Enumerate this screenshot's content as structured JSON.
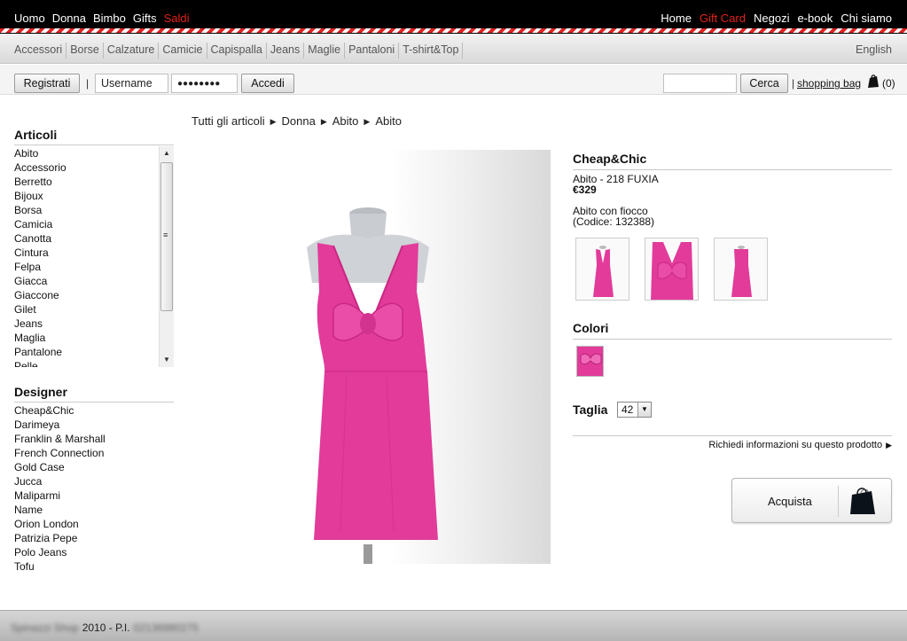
{
  "topnav": {
    "left": [
      {
        "label": "Uomo",
        "color": "#ffffff"
      },
      {
        "label": "Donna",
        "color": "#ffffff"
      },
      {
        "label": "Bimbo",
        "color": "#ffffff"
      },
      {
        "label": "Gifts",
        "color": "#ffffff"
      },
      {
        "label": "Saldi",
        "color": "#e32119"
      }
    ],
    "right": [
      {
        "label": "Home",
        "color": "#ffffff"
      },
      {
        "label": "Gift Card",
        "color": "#e32119"
      },
      {
        "label": "Negozi",
        "color": "#ffffff"
      },
      {
        "label": "e-book",
        "color": "#ffffff"
      },
      {
        "label": "Chi siamo",
        "color": "#ffffff"
      }
    ]
  },
  "categories": [
    "Accessori",
    "Borse",
    "Calzature",
    "Camicie",
    "Capispalla",
    "Jeans",
    "Maglie",
    "Pantaloni",
    "T-shirt&Top"
  ],
  "language": "English",
  "login": {
    "register_label": "Registrati",
    "separator": "|",
    "username_value": "Username",
    "password_value": "●●●●●●●●",
    "login_label": "Accedi",
    "search_value": "",
    "search_label": "Cerca",
    "bag_separator": "|",
    "bag_label": "shopping bag",
    "bag_count": "(0)",
    "bag_icon": "shopping-bag-icon"
  },
  "sidebar": {
    "articoli_title": "Articoli",
    "articoli": [
      "Abito",
      "Accessorio",
      "Berretto",
      "Bijoux",
      "Borsa",
      "Camicia",
      "Canotta",
      "Cintura",
      "Felpa",
      "Giacca",
      "Giaccone",
      "Gilet",
      "Jeans",
      "Maglia",
      "Pantalone",
      "Pelle"
    ],
    "designer_title": "Designer",
    "designers": [
      "Cheap&Chic",
      "Darimeya",
      "Franklin & Marshall",
      "French Connection",
      "Gold Case",
      "Jucca",
      "Maliparmi",
      "Name",
      "Orion London",
      "Patrizia Pepe",
      "Polo Jeans",
      "Tofu"
    ]
  },
  "breadcrumb": [
    "Tutti gli articoli",
    "Donna",
    "Abito",
    "Abito"
  ],
  "product": {
    "brand": "Cheap&Chic",
    "name": "Abito - 218 FUXIA",
    "price": "€329",
    "description": "Abito con fiocco",
    "code": "(Codice: 132388)",
    "colors_title": "Colori",
    "size_label": "Taglia",
    "size_value": "42",
    "info_link": "Richiedi informazioni su questo prodotto",
    "buy_label": "Acquista",
    "dress_color": "#e23b9a"
  },
  "footer": {
    "blurred_name": "Spinazzi Shop",
    "year_text": "2010 - P.I.",
    "blurred_vat": "02136980275"
  }
}
